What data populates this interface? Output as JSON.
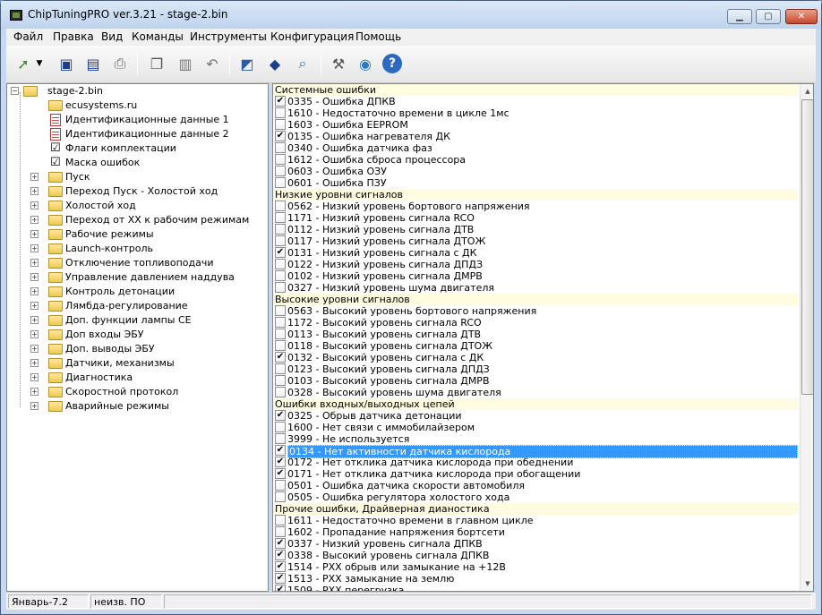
{
  "window": {
    "title": "ChipTuningPRO ver.3.21 - stage-2.bin"
  },
  "menu": [
    "Файл",
    "Правка",
    "Вид",
    "Команды",
    "Инструменты",
    "Конфигурация",
    "Помощь"
  ],
  "toolbar": {
    "icons": [
      "open-icon",
      "save-icon",
      "save-as-icon",
      "print-icon",
      "copy-icon",
      "paste-icon",
      "undo-icon",
      "report-icon",
      "info-icon",
      "search-icon",
      "tools-icon",
      "network-icon",
      "help-icon"
    ]
  },
  "tree": {
    "root": "stage-2.bin",
    "leaves": [
      {
        "label": "ecusystems.ru",
        "kind": "folder"
      },
      {
        "label": "Идентификационные данные 1",
        "kind": "doc"
      },
      {
        "label": "Идентификационные данные 2",
        "kind": "doc"
      },
      {
        "label": "Флаги комплектации",
        "kind": "check"
      },
      {
        "label": "Маска ошибок",
        "kind": "check"
      }
    ],
    "folders": [
      "Пуск",
      "Переход Пуск - Холостой ход",
      "Холостой ход",
      "Переход от ХХ к рабочим режимам",
      "Рабочие режимы",
      "Launch-контроль",
      "Отключение топливоподачи",
      "Управление давлением наддува",
      "Контроль детонации",
      "Лямбда-регулирование",
      "Доп. функции лампы CE",
      "Доп входы ЭБУ",
      "Доп. выводы ЭБУ",
      "Датчики, механизмы",
      "Диагностика",
      "Скоростной протокол",
      "Аварийные режимы"
    ]
  },
  "errors": [
    {
      "header": "Системные ошибки"
    },
    {
      "text": "0335 - Ошибка ДПКВ",
      "checked": true
    },
    {
      "text": "1610 - Недостаточно времени в цикле 1мс",
      "checked": false
    },
    {
      "text": "1603 - Ошибка EEPROM",
      "checked": false
    },
    {
      "text": "0135 - Ошибка нагревателя ДК",
      "checked": true
    },
    {
      "text": "0340 - Ошибка датчика фаз",
      "checked": false
    },
    {
      "text": "1612 - Ошибка сброса процессора",
      "checked": false
    },
    {
      "text": "0603 - Ошибка ОЗУ",
      "checked": false
    },
    {
      "text": "0601 - Ошибка ПЗУ",
      "checked": false
    },
    {
      "header": "Низкие уровни сигналов"
    },
    {
      "text": "0562 - Низкий уровень бортового напряжения",
      "checked": false
    },
    {
      "text": "1171 - Низкий уровень сигнала RCO",
      "checked": false
    },
    {
      "text": "0112 - Низкий уровень сигнала ДТВ",
      "checked": false
    },
    {
      "text": "0117 - Низкий уровень сигнала ДТОЖ",
      "checked": false
    },
    {
      "text": "0131 - Низкий уровень сигнала с ДК",
      "checked": true
    },
    {
      "text": "0122 - Низкий уровень сигнала ДПДЗ",
      "checked": false
    },
    {
      "text": "0102 - Низкий уровень сигнала ДМРВ",
      "checked": false
    },
    {
      "text": "0327 - Низкий уровень шума двигателя",
      "checked": false
    },
    {
      "header": "Высокие уровни сигналов"
    },
    {
      "text": "0563 - Высокий уровень бортового напряжения",
      "checked": false
    },
    {
      "text": "1172 - Высокий уровень сигнала RCO",
      "checked": false
    },
    {
      "text": "0113 - Высокий уровень сигнала ДТВ",
      "checked": false
    },
    {
      "text": "0118 - Высокий уровень сигнала ДТОЖ",
      "checked": false
    },
    {
      "text": "0132 - Высокий уровень сигнала с ДК",
      "checked": true
    },
    {
      "text": "0123 - Высокий уровень сигнала ДПДЗ",
      "checked": false
    },
    {
      "text": "0103 - Высокий уровень сигнала ДМРВ",
      "checked": false
    },
    {
      "text": "0328 - Высокий уровень шума двигателя",
      "checked": false
    },
    {
      "header": "Ошибки входных/выходных цепей"
    },
    {
      "text": "0325 - Обрыв датчика детонации",
      "checked": true
    },
    {
      "text": "1600 - Нет связи с иммобилайзером",
      "checked": false
    },
    {
      "text": "3999 - Не используется",
      "checked": false
    },
    {
      "text": "0134 - Нет активности датчика кислорода",
      "checked": true,
      "selected": true
    },
    {
      "text": "0172 - Нет отклика датчика кислорода при обеднении",
      "checked": true
    },
    {
      "text": "0171 - Нет отклика датчика кислорода при обогащении",
      "checked": true
    },
    {
      "text": "0501 - Ошибка датчика скорости автомобиля",
      "checked": false
    },
    {
      "text": "0505 - Ошибка регулятора холостого хода",
      "checked": false
    },
    {
      "header": "Прочие ошибки, Драйверная дианостика"
    },
    {
      "text": "1611 - Недостаточно времени в главном цикле",
      "checked": false
    },
    {
      "text": "1602 - Пропадание напряжения бортсети",
      "checked": false
    },
    {
      "text": "0337 - Низкий уровень сигнала ДПКВ",
      "checked": true
    },
    {
      "text": "0338 - Высокий уровень сигнала ДПКВ",
      "checked": true
    },
    {
      "text": "1514 - РХХ обрыв или замыкание на +12В",
      "checked": true
    },
    {
      "text": "1513 - РХХ замыкание на землю",
      "checked": true
    },
    {
      "text": "1509 - РХХ перегрузка",
      "checked": true
    }
  ],
  "status": {
    "firmware": "Январь-7.2",
    "software": "неизв. ПО"
  }
}
